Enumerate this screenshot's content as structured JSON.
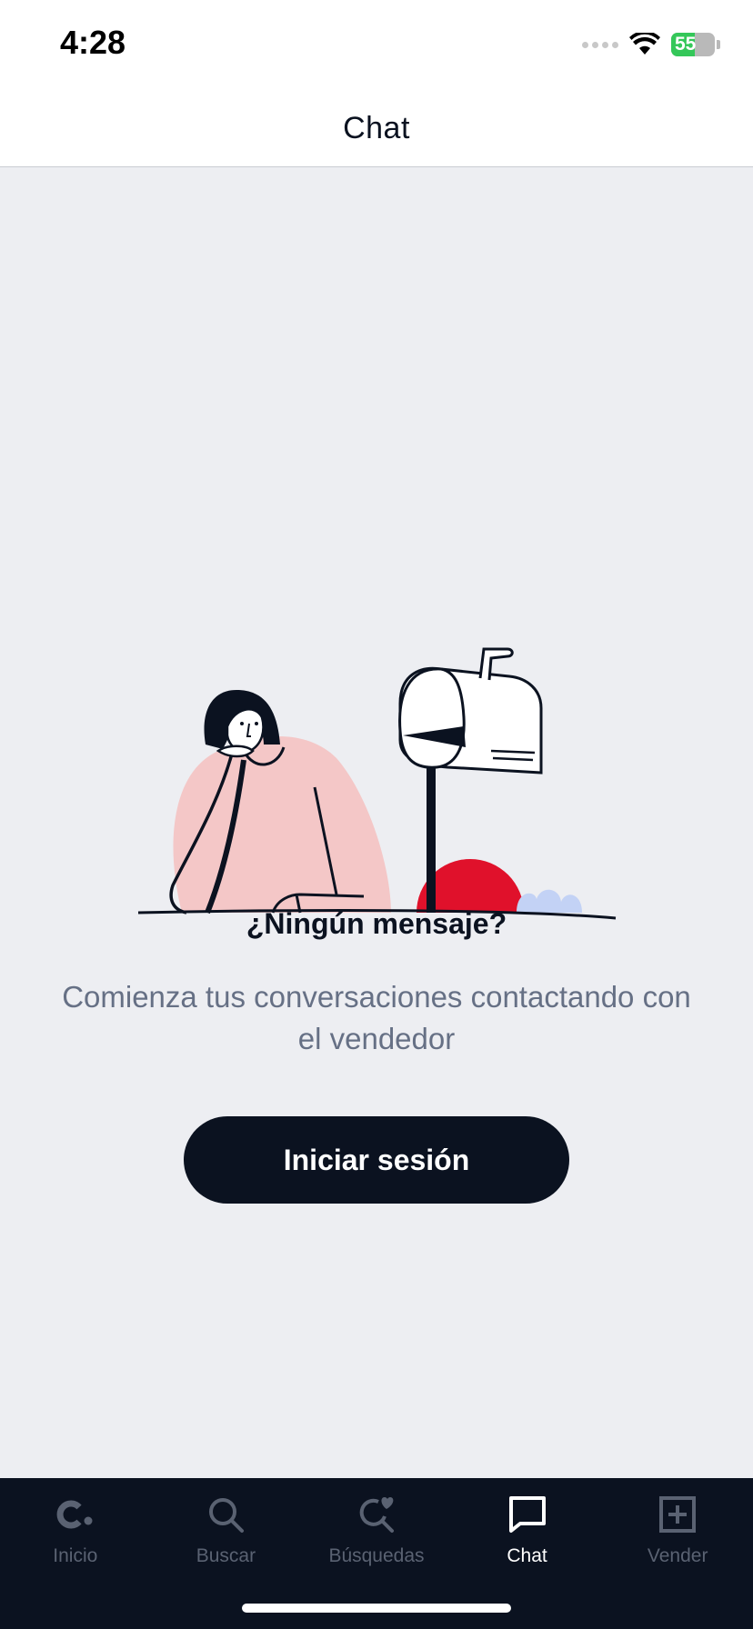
{
  "status_bar": {
    "time": "4:28",
    "battery_percent": "55",
    "battery_color": "#34c759",
    "icons": [
      "signal-dots-icon",
      "wifi-icon",
      "battery-icon"
    ]
  },
  "header": {
    "title": "Chat"
  },
  "empty_state": {
    "illustration": "person-waiting-mailbox-illustration",
    "title": "¿Ningún mensaje?",
    "subtitle": "Comienza tus conversaciones contactando con el vendedor",
    "button_label": "Iniciar sesión"
  },
  "tab_bar": {
    "items": [
      {
        "label": "Inicio",
        "icon": "logo-icon",
        "active": false
      },
      {
        "label": "Buscar",
        "icon": "search-icon",
        "active": false
      },
      {
        "label": "Búsquedas",
        "icon": "saved-search-heart-icon",
        "active": false
      },
      {
        "label": "Chat",
        "icon": "chat-bubble-icon",
        "active": true
      },
      {
        "label": "Vender",
        "icon": "plus-square-icon",
        "active": false
      }
    ]
  },
  "colors": {
    "brand_dark": "#0b1220",
    "background": "#edeef2",
    "accent_red": "#e0112b",
    "skin_pink": "#f4c7c7",
    "muted_text": "#667085"
  }
}
